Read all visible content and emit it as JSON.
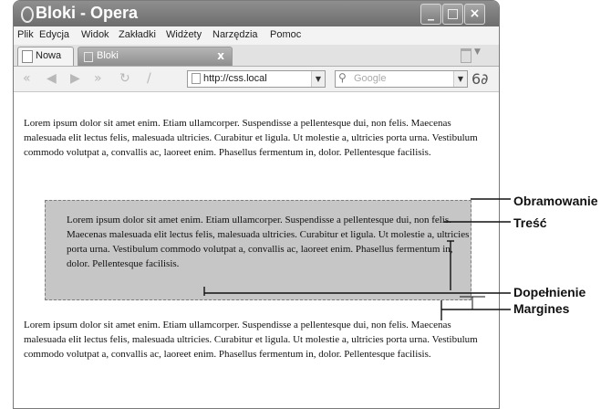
{
  "window": {
    "title": "Bloki - Opera"
  },
  "menu": {
    "items": [
      "Plik",
      "Edycja",
      "Widok",
      "Zakładki",
      "Widżety",
      "Narzędzia",
      "Pomoc"
    ]
  },
  "tabs": {
    "new_label": "Nowa",
    "active_label": "Bloki",
    "close_glyph": "x"
  },
  "toolbar": {
    "address_value": "http://css.local",
    "search_placeholder": "Google",
    "icons": [
      "back-icon",
      "forward-icon",
      "fast-forward-icon",
      "fast-forward-end-icon",
      "reload-icon",
      "edit-icon",
      "page-icon",
      "search-icon",
      "glasses-icon"
    ]
  },
  "content": {
    "paragraph_1": "Lorem ipsum dolor sit amet enim. Etiam ullamcorper. Suspendisse a pellentesque dui, non felis. Maecenas malesuada elit lectus felis, malesuada ultricies. Curabitur et ligula. Ut molestie a, ultricies porta urna. Vestibulum commodo volutpat a, convallis ac, laoreet enim. Phasellus fermentum in, dolor. Pellentesque facilisis.",
    "box_text": "Lorem ipsum dolor sit amet enim. Etiam ullamcorper. Suspendisse a pellentesque dui, non felis. Maecenas malesuada elit lectus felis, malesuada ultricies. Curabitur et ligula. Ut molestie a, ultricies porta urna. Vestibulum commodo volutpat a, convallis ac, laoreet enim. Phasellus fermentum in, dolor. Pellentesque facilisis.",
    "paragraph_2": "Lorem ipsum dolor sit amet enim. Etiam ullamcorper. Suspendisse a pellentesque dui, non felis. Maecenas malesuada elit lectus felis, malesuada ultricies. Curabitur et ligula. Ut molestie a, ultricies porta urna. Vestibulum commodo volutpat a, convallis ac, laoreet enim. Phasellus fermentum in, dolor. Pellentesque facilisis."
  },
  "callouts": {
    "border": "Obramowanie",
    "content": "Treść",
    "padding": "Dopełnienie",
    "margin": "Margines"
  }
}
